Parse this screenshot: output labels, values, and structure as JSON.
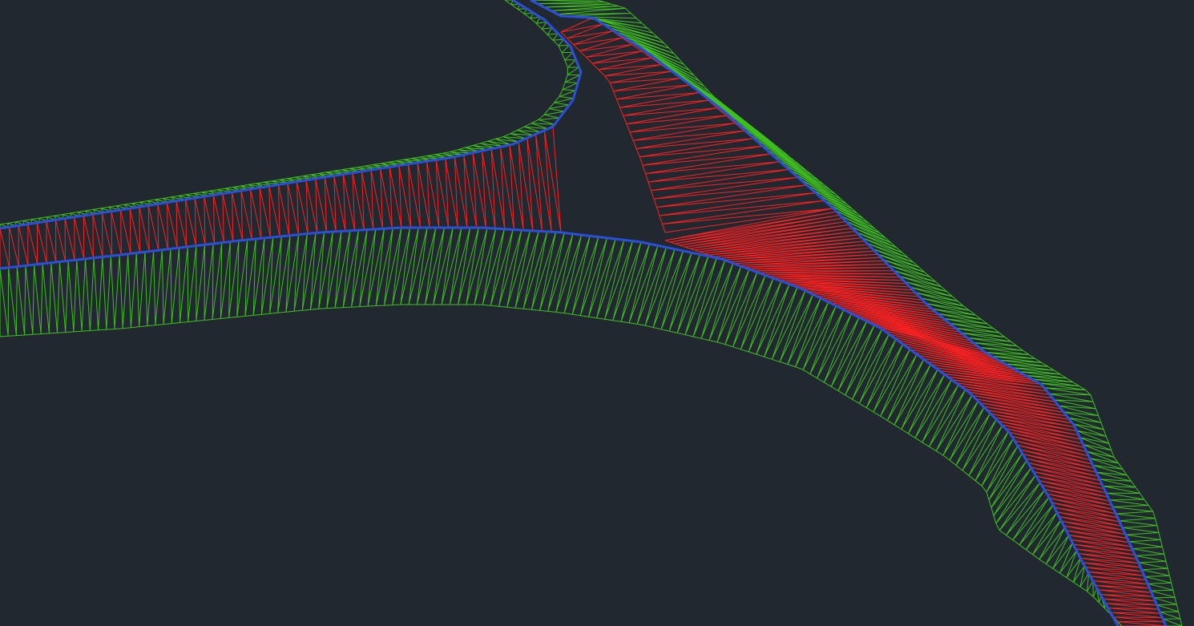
{
  "viewport": {
    "background": "#212830"
  },
  "layers": {
    "pavement": {
      "name": "pavement-tin",
      "color": "#ff2020"
    },
    "curb": {
      "name": "curb-edge",
      "color": "#2a4fd8"
    },
    "slope": {
      "name": "daylight-slope",
      "color": "#3fbf1f"
    }
  }
}
